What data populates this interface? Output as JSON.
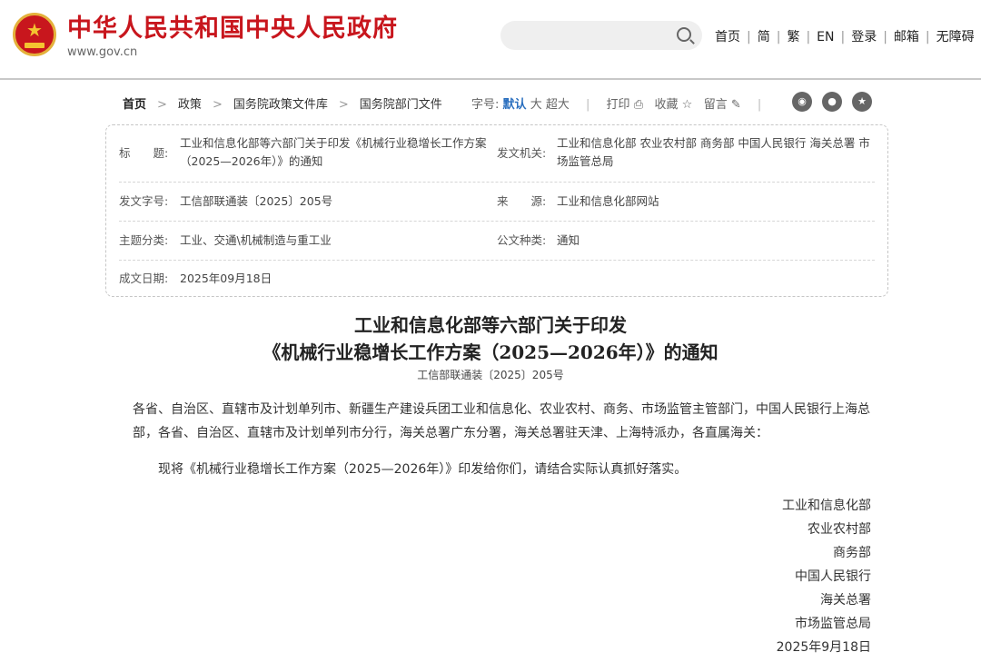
{
  "header": {
    "title": "中华人民共和国中央人民政府",
    "url": "www.gov.cn",
    "search": {
      "placeholder": ""
    },
    "nav": [
      "首页",
      "简",
      "繁",
      "EN",
      "登录",
      "邮箱",
      "无障碍"
    ]
  },
  "toolbar": {
    "breadcrumb": [
      "首页",
      "政策",
      "国务院政策文件库",
      "国务院部门文件"
    ],
    "font_label": "字号:",
    "font_default": "默认",
    "font_large": "大",
    "font_xlarge": "超大",
    "print": "打印",
    "favorite": "收藏",
    "comment": "留言",
    "share_icons": [
      "weibo-icon",
      "wechat-icon",
      "star-icon"
    ]
  },
  "meta": {
    "title_label": "标　　题:",
    "title_value_1": "工业和信息化部等六部门关于印发《机械行业稳增长工作方案",
    "title_value_2": "（2025—2026年）》的通知",
    "issuer_label": "发文机关:",
    "issuer_value_1": "工业和信息化部 农业农村部 商务部 中国人民银行 海关总署 市",
    "issuer_value_2": "场监管总局",
    "docno_label": "发文字号:",
    "docno_value": "工信部联通装〔2025〕205号",
    "source_label": "来　　源:",
    "source_value": "工业和信息化部网站",
    "topic_label": "主题分类:",
    "topic_value": "工业、交通\\机械制造与重工业",
    "type_label": "公文种类:",
    "type_value": "通知",
    "date_label": "成文日期:",
    "date_value": "2025年09月18日"
  },
  "article": {
    "title_line1": "工业和信息化部等六部门关于印发",
    "title_line2": "《机械行业稳增长工作方案（2025—2026年）》的通知",
    "doc_number": "工信部联通装〔2025〕205号",
    "recipients_1": "各省、自治区、直辖市及计划单列市、新疆生产建设兵团工业和信息化、农业农村、商务、市场监管主管部门，中国人民银行上海总",
    "recipients_2": "部，各省、自治区、直辖市及计划单列市分行，海关总署广东分署，海关总署驻天津、上海特派办，各直属海关：",
    "body": "现将《机械行业稳增长工作方案（2025—2026年）》印发给你们，请结合实际认真抓好落实。",
    "signatories": [
      "工业和信息化部",
      "农业农村部",
      "商务部",
      "中国人民银行",
      "海关总署",
      "市场监管总局"
    ],
    "date": "2025年9月18日"
  },
  "colors": {
    "brand_red": "#c8161d",
    "accent_blue": "#2a6fbf"
  }
}
